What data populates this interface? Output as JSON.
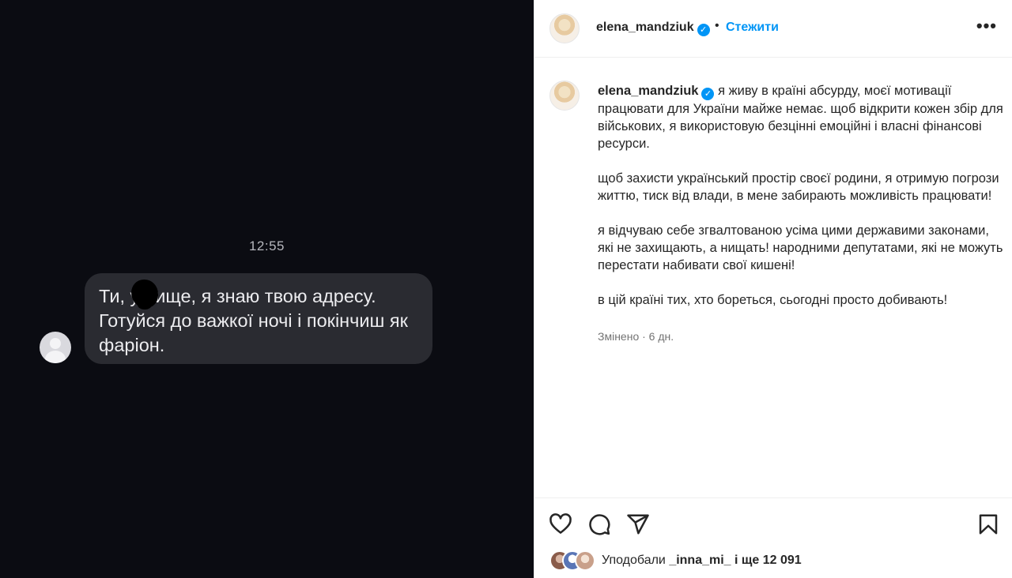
{
  "media": {
    "timestamp": "12:55",
    "message_lines": [
      "Ти, у   бище, я знаю твою адресу.",
      "Готуйся до важкої ночі і покінчиш як",
      "фаріон."
    ]
  },
  "header": {
    "username": "elena_mandziuk",
    "verified_mark": "✓",
    "separator": "•",
    "follow_label": "Стежити",
    "more_label": "•••"
  },
  "caption": {
    "username": "elena_mandziuk",
    "paragraphs": [
      "я живу в країні абсурду, моєї мотивації працювати для України майже немає. щоб відкрити кожен збір для військових, я використовую безцінні емоційні і власні фінансові ресурси.",
      "щоб захисти український простір своєї родини, я отримую погрози життю, тиск від влади, в мене забирають можливість працювати!",
      "я відчуваю себе згвалтованою усіма цими державими законами, які не захищають, а нищать! народними депутатами, які не можуть перестати набивати свої кишені!",
      "в цій країні тих, хто бореться, сьогодні просто добивають!"
    ],
    "meta": "Змінено · 6 дн."
  },
  "likes": {
    "prefix": "Уподобали",
    "user": "_inna_mi_",
    "suffix": "і ще 12 091"
  },
  "colors": {
    "accent": "#0095f6",
    "photo_bg": "#0b0c12",
    "bubble": "#2a2b31"
  }
}
